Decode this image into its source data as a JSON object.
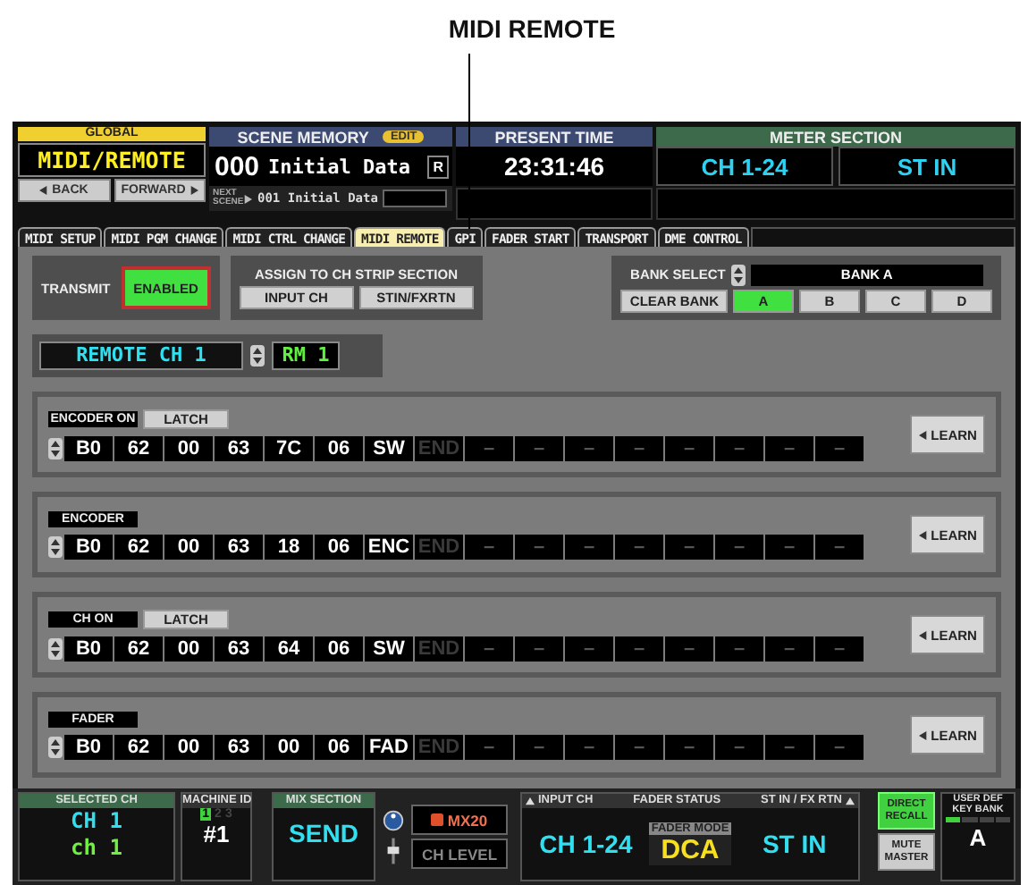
{
  "callout": "MIDI REMOTE",
  "header": {
    "global": {
      "label": "GLOBAL",
      "title": "MIDI/REMOTE",
      "back": "BACK",
      "forward": "FORWARD"
    },
    "scene_memory": {
      "title": "SCENE MEMORY",
      "edit": "EDIT",
      "number": "000",
      "name": "Initial Data",
      "recall": "R",
      "next_label": "NEXT SCENE",
      "next": "001 Initial Data"
    },
    "present_time": {
      "title": "PRESENT TIME",
      "time": "23:31:46"
    },
    "meter_section": {
      "title": "METER SECTION",
      "buttons": [
        "CH 1-24",
        "ST IN"
      ]
    }
  },
  "tabs": [
    {
      "label": "MIDI SETUP",
      "selected": false
    },
    {
      "label": "MIDI PGM CHANGE",
      "selected": false
    },
    {
      "label": "MIDI CTRL CHANGE",
      "selected": false
    },
    {
      "label": "MIDI REMOTE",
      "selected": true
    },
    {
      "label": "GPI",
      "selected": false
    },
    {
      "label": "FADER START",
      "selected": false
    },
    {
      "label": "TRANSPORT",
      "selected": false
    },
    {
      "label": "DME CONTROL",
      "selected": false
    }
  ],
  "transmit": {
    "label": "TRANSMIT",
    "button": "ENABLED",
    "on": true
  },
  "assign": {
    "title": "ASSIGN TO CH STRIP SECTION",
    "buttons": [
      "INPUT CH",
      "STIN/FXRTN"
    ]
  },
  "bank": {
    "label": "BANK SELECT",
    "name": "BANK A",
    "clear": "CLEAR BANK",
    "banks": [
      {
        "label": "A",
        "selected": true
      },
      {
        "label": "B",
        "selected": false
      },
      {
        "label": "C",
        "selected": false
      },
      {
        "label": "D",
        "selected": false
      }
    ]
  },
  "remote_ch": "REMOTE CH 1",
  "rm": "RM 1",
  "blocks": [
    {
      "label": "ENCODER ON",
      "latch": "LATCH",
      "bytes": [
        "B0",
        "62",
        "00",
        "63",
        "7C",
        "06",
        "SW"
      ],
      "end": "END",
      "blanks": [
        "–",
        "–",
        "–",
        "–",
        "–",
        "–",
        "–",
        "–"
      ],
      "learn": "LEARN"
    },
    {
      "label": "ENCODER",
      "bytes": [
        "B0",
        "62",
        "00",
        "63",
        "18",
        "06",
        "ENC"
      ],
      "end": "END",
      "blanks": [
        "–",
        "–",
        "–",
        "–",
        "–",
        "–",
        "–",
        "–"
      ],
      "learn": "LEARN"
    },
    {
      "label": "CH ON",
      "latch": "LATCH",
      "bytes": [
        "B0",
        "62",
        "00",
        "63",
        "64",
        "06",
        "SW"
      ],
      "end": "END",
      "blanks": [
        "–",
        "–",
        "–",
        "–",
        "–",
        "–",
        "–",
        "–"
      ],
      "learn": "LEARN"
    },
    {
      "label": "FADER",
      "bytes": [
        "B0",
        "62",
        "00",
        "63",
        "00",
        "06",
        "FAD"
      ],
      "end": "END",
      "blanks": [
        "–",
        "–",
        "–",
        "–",
        "–",
        "–",
        "–",
        "–"
      ],
      "learn": "LEARN"
    }
  ],
  "bottom": {
    "selected_ch": {
      "title": "SELECTED CH",
      "ch": "CH 1",
      "name": "ch 1"
    },
    "machine_id": {
      "title": "MACHINE ID",
      "ids": [
        {
          "label": "1",
          "selected": true
        },
        {
          "label": "2",
          "selected": false
        },
        {
          "label": "3",
          "selected": false
        }
      ],
      "value": "#1"
    },
    "mix_section": {
      "title": "MIX SECTION",
      "value": "SEND"
    },
    "mix": "MX20",
    "ch_level": "CH LEVEL",
    "fader_status": {
      "input_label": "INPUT CH",
      "title": "FADER STATUS",
      "stin_label": "ST IN / FX RTN",
      "input": "CH 1-24",
      "mode_label": "FADER MODE",
      "mode": "DCA",
      "stin": "ST IN"
    },
    "direct_recall": "DIRECT RECALL",
    "mute_master": "MUTE MASTER",
    "user_def": {
      "title": "USER DEF KEY BANK",
      "value": "A"
    }
  }
}
